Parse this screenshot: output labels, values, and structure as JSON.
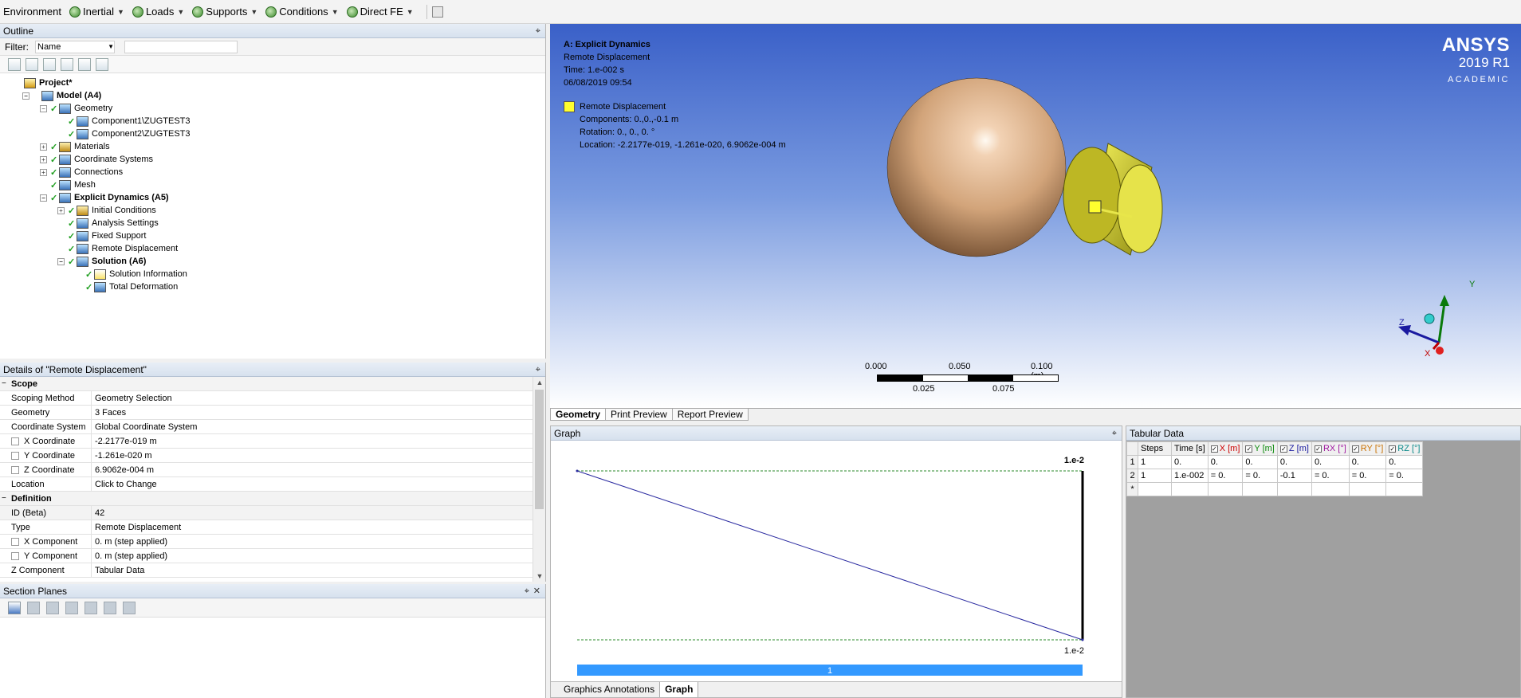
{
  "toolbar": {
    "items": [
      {
        "label": "Environment",
        "icon": "none",
        "caret": false
      },
      {
        "label": "Inertial",
        "icon": "inertial-icon",
        "caret": true
      },
      {
        "label": "Loads",
        "icon": "loads-icon",
        "caret": true
      },
      {
        "label": "Supports",
        "icon": "supports-icon",
        "caret": true
      },
      {
        "label": "Conditions",
        "icon": "conditions-icon",
        "caret": true
      },
      {
        "label": "Direct FE",
        "icon": "direct-fe-icon",
        "caret": true
      }
    ]
  },
  "outline": {
    "title": "Outline",
    "filter_label": "Filter:",
    "filter_value": "Name",
    "tree": [
      {
        "label": "Project*",
        "level": 0,
        "bold": true,
        "exp": "none",
        "check": false,
        "icon": "project"
      },
      {
        "label": "Model (A4)",
        "level": 1,
        "bold": true,
        "exp": "−",
        "check": false,
        "icon": "model"
      },
      {
        "label": "Geometry",
        "level": 2,
        "bold": false,
        "exp": "−",
        "check": true,
        "icon": "geometry"
      },
      {
        "label": "Component1\\ZUGTEST3",
        "level": 3,
        "bold": false,
        "exp": "none",
        "check": true,
        "icon": "body"
      },
      {
        "label": "Component2\\ZUGTEST3",
        "level": 3,
        "bold": false,
        "exp": "none",
        "check": true,
        "icon": "body"
      },
      {
        "label": "Materials",
        "level": 2,
        "bold": false,
        "exp": "+",
        "check": true,
        "icon": "materials"
      },
      {
        "label": "Coordinate Systems",
        "level": 2,
        "bold": false,
        "exp": "+",
        "check": true,
        "icon": "coord"
      },
      {
        "label": "Connections",
        "level": 2,
        "bold": false,
        "exp": "+",
        "check": true,
        "icon": "connections"
      },
      {
        "label": "Mesh",
        "level": 2,
        "bold": false,
        "exp": "none",
        "check": true,
        "icon": "mesh"
      },
      {
        "label": "Explicit Dynamics (A5)",
        "level": 2,
        "bold": true,
        "exp": "−",
        "check": true,
        "icon": "analysis"
      },
      {
        "label": "Initial Conditions",
        "level": 3,
        "bold": false,
        "exp": "+",
        "check": true,
        "icon": "materials"
      },
      {
        "label": "Analysis Settings",
        "level": 3,
        "bold": false,
        "exp": "none",
        "check": true,
        "icon": "settings"
      },
      {
        "label": "Fixed Support",
        "level": 3,
        "bold": false,
        "exp": "none",
        "check": true,
        "icon": "body"
      },
      {
        "label": "Remote Displacement",
        "level": 3,
        "bold": false,
        "exp": "none",
        "check": true,
        "icon": "body"
      },
      {
        "label": "Solution (A6)",
        "level": 3,
        "bold": true,
        "exp": "−",
        "check": true,
        "icon": "solution"
      },
      {
        "label": "Solution Information",
        "level": 4,
        "bold": false,
        "exp": "none",
        "check": true,
        "icon": "info"
      },
      {
        "label": "Total Deformation",
        "level": 4,
        "bold": false,
        "exp": "none",
        "check": true,
        "icon": "body"
      }
    ]
  },
  "details": {
    "title": "Details of \"Remote Displacement\"",
    "rows": [
      {
        "type": "section",
        "label": "Scope"
      },
      {
        "type": "row",
        "label": "Scoping Method",
        "value": "Geometry Selection",
        "cb": false
      },
      {
        "type": "row",
        "label": "Geometry",
        "value": "3 Faces",
        "cb": false
      },
      {
        "type": "row",
        "label": "Coordinate System",
        "value": "Global Coordinate System",
        "cb": false
      },
      {
        "type": "row",
        "label": "X Coordinate",
        "value": "-2.2177e-019 m",
        "cb": true
      },
      {
        "type": "row",
        "label": "Y Coordinate",
        "value": "-1.261e-020 m",
        "cb": true
      },
      {
        "type": "row",
        "label": "Z Coordinate",
        "value": "6.9062e-004 m",
        "cb": true
      },
      {
        "type": "row",
        "label": "Location",
        "value": "Click to Change",
        "cb": false
      },
      {
        "type": "section",
        "label": "Definition"
      },
      {
        "type": "row",
        "label": "ID (Beta)",
        "value": "42",
        "cb": false,
        "shade": true
      },
      {
        "type": "row",
        "label": "Type",
        "value": "Remote Displacement",
        "cb": false
      },
      {
        "type": "row",
        "label": "X Component",
        "value": "0. m  (step applied)",
        "cb": true
      },
      {
        "type": "row",
        "label": "Y Component",
        "value": "0. m  (step applied)",
        "cb": true
      },
      {
        "type": "row",
        "label": "Z Component",
        "value": "Tabular Data",
        "cb": false
      }
    ]
  },
  "section_planes": {
    "title": "Section Planes"
  },
  "viewport": {
    "info": {
      "title": "A: Explicit Dynamics",
      "line1": "Remote Displacement",
      "line2": "Time: 1.e-002 s",
      "line3": "06/08/2019 09:54"
    },
    "legend": {
      "name": "Remote Displacement",
      "components": "Components: 0.,0.,-0.1 m",
      "rotation": "Rotation: 0., 0., 0. °",
      "location": "Location: -2.2177e-019, -1.261e-020, 6.9062e-004 m",
      "swatch_color": "#ffff2e"
    },
    "brand": {
      "name": "ANSYS",
      "version": "2019 R1",
      "edition": "ACADEMIC"
    },
    "scale": {
      "labels_top": [
        "0.000",
        "0.050",
        "0.100 (m)"
      ],
      "labels_bottom": [
        "0.025",
        "0.075"
      ]
    },
    "triad": {
      "x": "X",
      "y": "Y",
      "z": "Z"
    }
  },
  "view_tabs": [
    "Geometry",
    "Print Preview",
    "Report Preview"
  ],
  "graph": {
    "title": "Graph",
    "top_label": "1.e-2",
    "bottom_label": "1.e-2",
    "bar_label": "1",
    "tabs": [
      "Graphics Annotations",
      "Graph"
    ],
    "line_color": "#2a2aa0",
    "bar_color": "#3399ff"
  },
  "tabular": {
    "title": "Tabular Data",
    "headers": [
      {
        "label": "Steps",
        "cb": false,
        "color": "#000000"
      },
      {
        "label": "Time [s]",
        "cb": false,
        "color": "#000000"
      },
      {
        "label": "X [m]",
        "cb": true,
        "color": "#cc0000"
      },
      {
        "label": "Y [m]",
        "cb": true,
        "color": "#0a8a0a"
      },
      {
        "label": "Z [m]",
        "cb": true,
        "color": "#1a1aa0"
      },
      {
        "label": "RX [°]",
        "cb": true,
        "color": "#a01aa0"
      },
      {
        "label": "RY [°]",
        "cb": true,
        "color": "#c87000"
      },
      {
        "label": "RZ [°]",
        "cb": true,
        "color": "#0a8a8a"
      }
    ],
    "rows": [
      {
        "rh": "1",
        "cells": [
          "1",
          "0.",
          "0.",
          "0.",
          "0.",
          "0.",
          "0.",
          "0."
        ]
      },
      {
        "rh": "2",
        "cells": [
          "1",
          "1.e-002",
          "= 0.",
          "= 0.",
          "-0.1",
          "= 0.",
          "= 0.",
          "= 0."
        ]
      },
      {
        "rh": "*",
        "cells": [
          "",
          "",
          "",
          "",
          "",
          "",
          "",
          ""
        ]
      }
    ]
  }
}
